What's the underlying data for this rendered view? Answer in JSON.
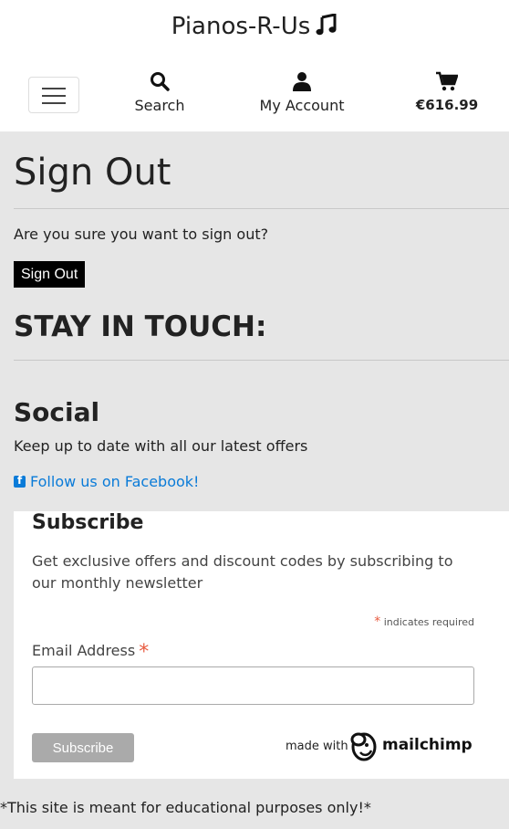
{
  "header": {
    "brand": "Pianos-R-Us",
    "brand_icon": "music-note-icon",
    "nav": {
      "search": {
        "label": "Search",
        "icon": "search-icon"
      },
      "account": {
        "label": "My Account",
        "icon": "user-icon"
      },
      "cart": {
        "label": "€616.99",
        "icon": "cart-icon"
      }
    }
  },
  "main": {
    "title": "Sign Out",
    "question": "Are you sure you want to sign out?",
    "signout_label": "Sign Out",
    "stay_in_touch": "STAY IN TOUCH:",
    "social_heading": "Social",
    "social_text": "Keep up to date with all our latest offers",
    "facebook_link": "Follow us on Facebook!"
  },
  "subscribe": {
    "heading": "Subscribe",
    "description": "Get exclusive offers and discount codes by subscribing to our monthly newsletter",
    "required_note": "indicates required",
    "required_mark": "*",
    "email_label": "Email Address",
    "email_value": "",
    "button_label": "Subscribe",
    "made_with": "made with",
    "brand": "mailchimp"
  },
  "footer": {
    "note": "*This site is meant for educational purposes only!*"
  },
  "colors": {
    "link": "#0a7bd8",
    "required": "#e85c41",
    "page_bg": "#e6e6e6"
  }
}
